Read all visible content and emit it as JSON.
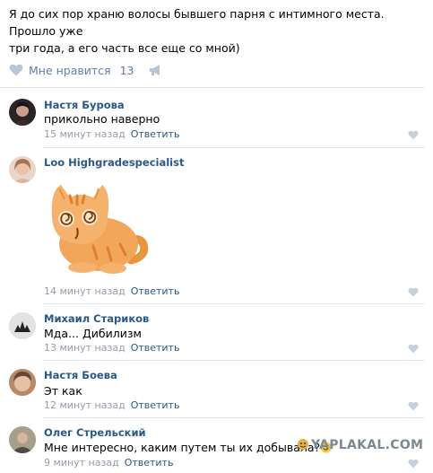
{
  "post": {
    "text_line1": "Я до сих пор храню волосы бывшего парня с интимного места. Прошло уже",
    "text_line2": "три года, а его часть все еще со мной)"
  },
  "likes": {
    "label": "Мне нравится",
    "count": "13",
    "heart_icon": "heart-icon",
    "share_icon": "share-megaphone-icon"
  },
  "comments": [
    {
      "name": "Настя Бурова",
      "text": "прикольно наверно",
      "time": "15 минут назад",
      "reply": "Ответить"
    },
    {
      "name": "Loo Highgradespecialist",
      "text": "",
      "time": "14 минут назад",
      "reply": "Ответить",
      "sticker": "orange-cat-sticker"
    },
    {
      "name": "Михаил Стариков",
      "text": "Мда... Дибилизм",
      "time": "13 минут назад",
      "reply": "Ответить"
    },
    {
      "name": "Настя Боева",
      "text": "Эт как",
      "time": "12 минут назад",
      "reply": "Ответить"
    },
    {
      "name": "Олег Стрельский",
      "text": "Мне интересно, каким путем ты их добывала?",
      "time": "9 минут назад",
      "reply": "Ответить"
    }
  ],
  "watermark": "YAPLAKAL.COM",
  "colors": {
    "link": "#2a5885",
    "meta": "#939ca7",
    "divider": "#e3e7ec",
    "like_blue": "#5e7fa5"
  }
}
